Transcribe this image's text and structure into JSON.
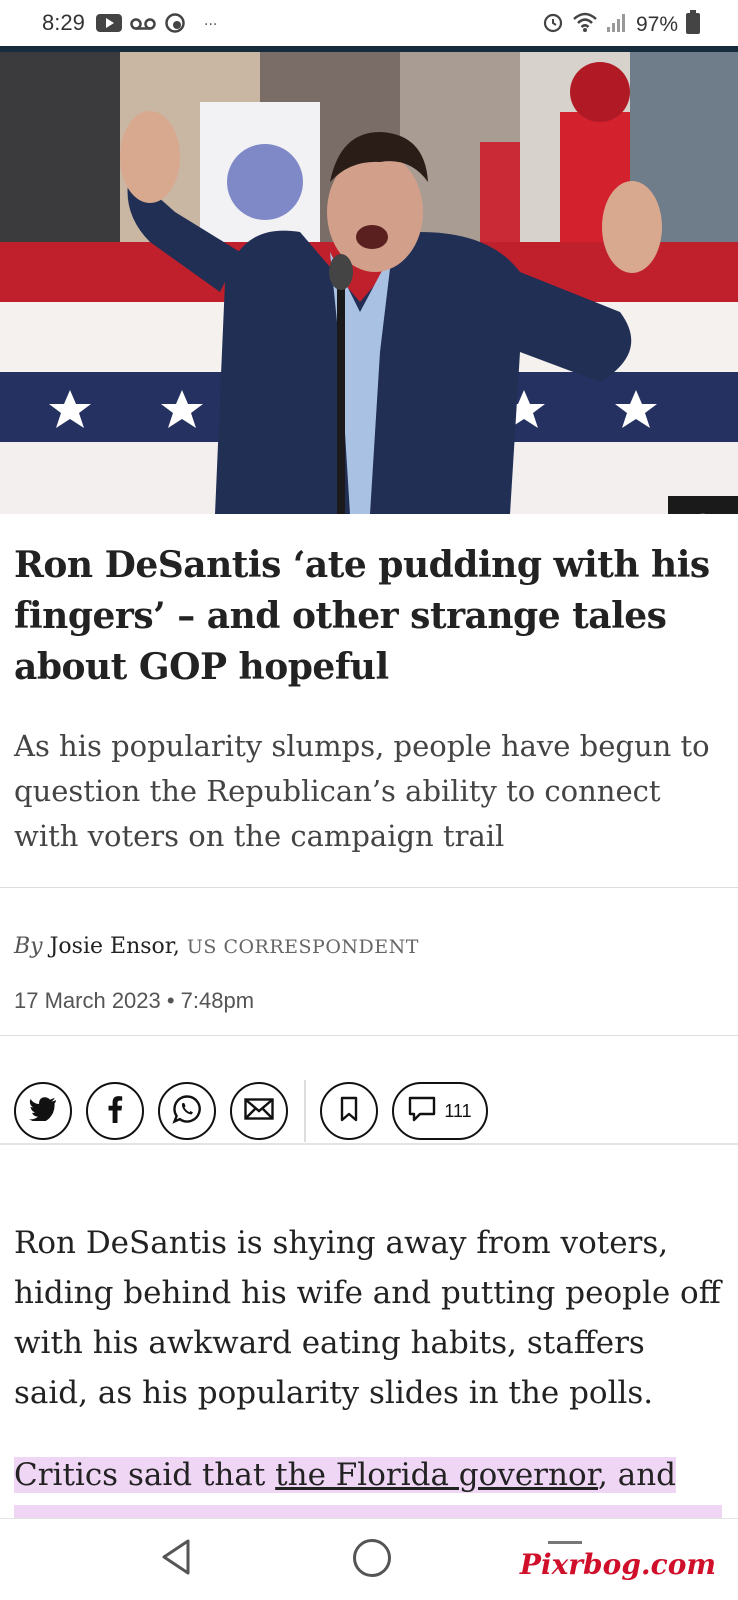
{
  "status_bar": {
    "time": "8:29",
    "ellipsis": "···",
    "battery": "97%",
    "left_icons": [
      "youtube-icon",
      "voicemail-icon",
      "sync-icon"
    ],
    "right_icons": [
      "alarm-icon",
      "wifi-icon",
      "signal-icon",
      "battery-icon"
    ]
  },
  "article": {
    "headline": "Ron DeSantis ‘ate pudding with his fingers’ – and other strange tales about GOP hopeful",
    "standfirst": "As his popularity slumps, people have begun to question the Republican’s ability to connect with voters on the campaign trail",
    "byline_prefix": "By",
    "author": "Josie Ensor,",
    "author_role": "US CORRESPONDENT",
    "date": "17 March 2023 • 7:48pm",
    "comment_count": "111",
    "body_para_1": "Ron DeSantis is shying away from voters, hiding behind his wife and putting people off with his awkward eating habits, staffers said, as his popularity slides in the polls.",
    "body_para_2_start": "Critics said that ",
    "body_para_2_link": "the Florida governor",
    "body_para_2_end": ", and"
  },
  "share_buttons": [
    "twitter-icon",
    "facebook-icon",
    "whatsapp-icon",
    "email-icon"
  ],
  "watermark": "Pixrbog.com",
  "colors": {
    "highlight": "#f0d6f5",
    "top_rule": "#172c3c",
    "watermark": "#d0102a"
  }
}
